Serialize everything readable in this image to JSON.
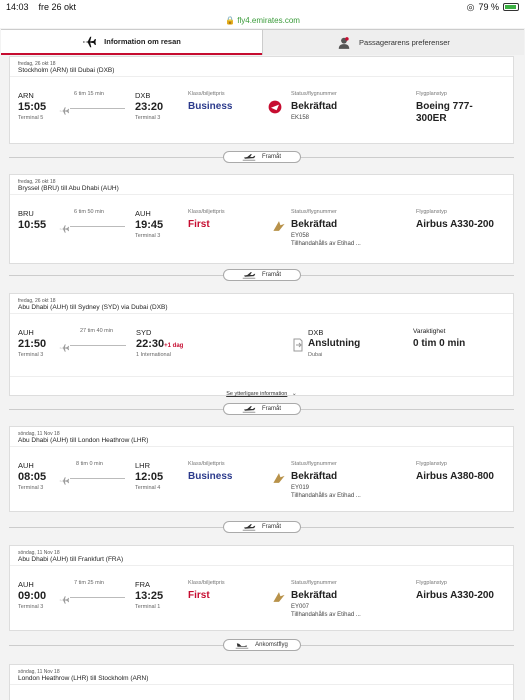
{
  "status": {
    "time": "14:03",
    "date": "fre 26 okt",
    "battery": "79 %"
  },
  "url": "fly4.emirates.com",
  "tabs": {
    "info": "Information om resan",
    "prefs": "Passagerarens preferenser"
  },
  "labels": {
    "klass": "Klass/biljettpris",
    "status": "Status/flygnummer",
    "plantyp": "Flygplanstyp",
    "varaktighet": "Varaktighet"
  },
  "cards": [
    {
      "date": "fredag, 26 okt 18",
      "route": "Stockholm (ARN) till Dubai (DXB)",
      "from_code": "ARN",
      "from_time": "15:05",
      "from_term": "Terminal 5",
      "dur": "6 tim 15 min",
      "to_code": "DXB",
      "to_time": "23:20",
      "to_term": "Terminal 3",
      "class": "Business",
      "status": "Bekräftad",
      "flight": "EK158",
      "operator": "",
      "aircraft": "Boeing 777-300ER"
    },
    {
      "date": "fredag, 26 okt 18",
      "route": "Bryssel (BRU) till Abu Dhabi (AUH)",
      "from_code": "BRU",
      "from_time": "10:55",
      "from_term": "",
      "dur": "6 tim 50 min",
      "to_code": "AUH",
      "to_time": "19:45",
      "to_term": "Terminal 3",
      "class": "First",
      "status": "Bekräftad",
      "flight": "EY058",
      "operator": "Tillhandahålls av Etihad ...",
      "aircraft": "Airbus A330-200"
    },
    {
      "date": "fredag, 26 okt 18",
      "route": "Abu Dhabi (AUH) till Sydney (SYD) via Dubai (DXB)",
      "from_code": "AUH",
      "from_time": "21:50",
      "from_term": "Terminal 3",
      "dur": "27 tim 40 min",
      "to_code": "SYD",
      "to_time": "22:30",
      "to_plus": "+1 dag",
      "to_term": "1 International",
      "via_code": "DXB",
      "via_label": "Anslutning",
      "via_city": "Dubai",
      "duration_value": "0 tim 0 min",
      "more": "Se ytterligare information"
    },
    {
      "date": "söndag, 11 Nov 18",
      "route": "Abu Dhabi (AUH) till London Heathrow (LHR)",
      "from_code": "AUH",
      "from_time": "08:05",
      "from_term": "Terminal 3",
      "dur": "8 tim 0 min",
      "to_code": "LHR",
      "to_time": "12:05",
      "to_term": "Terminal 4",
      "class": "Business",
      "status": "Bekräftad",
      "flight": "EY019",
      "operator": "Tillhandahålls av Etihad ...",
      "aircraft": "Airbus A380-800"
    },
    {
      "date": "söndag, 11 Nov 18",
      "route": "Abu Dhabi (AUH) till Frankfurt (FRA)",
      "from_code": "AUH",
      "from_time": "09:00",
      "from_term": "Terminal 3",
      "dur": "7 tim 25 min",
      "to_code": "FRA",
      "to_time": "13:25",
      "to_term": "Terminal 1",
      "class": "First",
      "status": "Bekräftad",
      "flight": "EY007",
      "operator": "Tillhandahålls av Etihad ...",
      "aircraft": "Airbus A330-200"
    },
    {
      "date": "söndag, 11 Nov 18",
      "route": "London Heathrow (LHR) till Stockholm (ARN)"
    }
  ],
  "separators": [
    "Framåt",
    "Framåt",
    "Framåt",
    "Framåt",
    "Ankomstflyg"
  ]
}
